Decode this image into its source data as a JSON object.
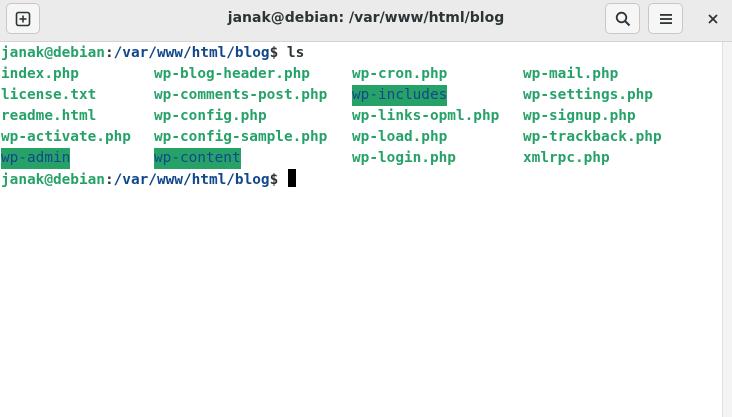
{
  "window": {
    "title": "janak@debian: /var/www/html/blog"
  },
  "toolbar": {
    "new_tab_icon": "new-tab-plus-icon",
    "search_icon": "search-icon",
    "menu_icon": "hamburger-menu-icon",
    "close_icon": "close-icon"
  },
  "colors": {
    "prompt_user": "#26a269",
    "prompt_path": "#12488b",
    "file": "#26a269",
    "highlight_bg": "#26a269",
    "highlight_fg": "#12488b",
    "titlebar": "#ebebeb"
  },
  "terminal": {
    "prompt_user": "janak@debian",
    "prompt_colon": ":",
    "prompt_path": "/var/www/html/blog",
    "prompt_dollar": "$ ",
    "command": "ls",
    "listing": [
      [
        "index.php",
        "wp-blog-header.php",
        "wp-cron.php",
        "wp-mail.php"
      ],
      [
        "license.txt",
        "wp-comments-post.php",
        "wp-includes",
        "wp-settings.php"
      ],
      [
        "readme.html",
        "wp-config.php",
        "wp-links-opml.php",
        "wp-signup.php"
      ],
      [
        "wp-activate.php",
        "wp-config-sample.php",
        "wp-load.php",
        "wp-trackback.php"
      ],
      [
        "wp-admin",
        "wp-content",
        "wp-login.php",
        "xmlrpc.php"
      ]
    ]
  }
}
